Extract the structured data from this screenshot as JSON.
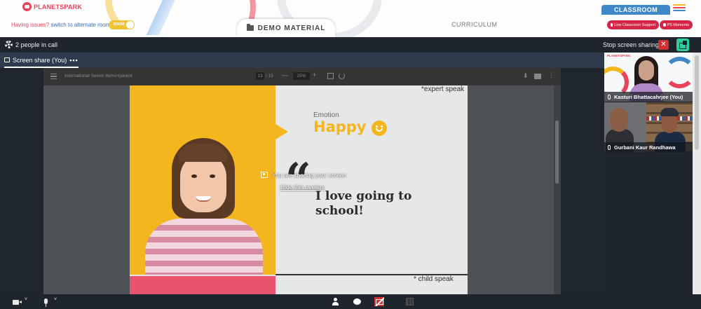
{
  "header": {
    "logo_text": "PLANETSPARK",
    "issues_text": "Having issues?",
    "alternate_link": "switch to alternate room",
    "room_toggle_label": "ROOM",
    "demo_material_label": "DEMO MATERIAL",
    "curriculum_label": "CURRICULUM",
    "classroom_tab_label": "CLASSROOM",
    "live_support_label": "Live Classroom Support",
    "ps_moments_label": "PS Moments",
    "menu_colors": [
      "#f3b61e",
      "#e8435a",
      "#3f88c8"
    ]
  },
  "call": {
    "people_count_text": "2 people in call",
    "stop_sharing_label": "Stop screen sharing",
    "stop_icon": "✕"
  },
  "tab": {
    "label": "Screen share (You)",
    "menu": "•••"
  },
  "pdf": {
    "title": "International Senior demo+parent",
    "page_current": "13",
    "page_total": "/ 15",
    "zoom": "25%",
    "minus": "—",
    "plus": "+",
    "download": "⬇",
    "more": "⋮"
  },
  "slide": {
    "expert_note": "*expert speak",
    "emotion_label": "Emotion",
    "emotion_value": "Happy",
    "quote_mark": "“",
    "quote_text": "I love going to school!",
    "child_note": "* child speak",
    "colors": {
      "yellow": "#f3b61e",
      "pink": "#e8546d"
    }
  },
  "overlay": {
    "message": "You are sharing your screen",
    "hide_link": "Hide this overlay"
  },
  "participants": [
    {
      "name": "Kasturi Bhattacahrjee (You)"
    },
    {
      "name": "Gurbani Kaur Randhawa"
    }
  ],
  "controls": {
    "chevron": "˅"
  }
}
